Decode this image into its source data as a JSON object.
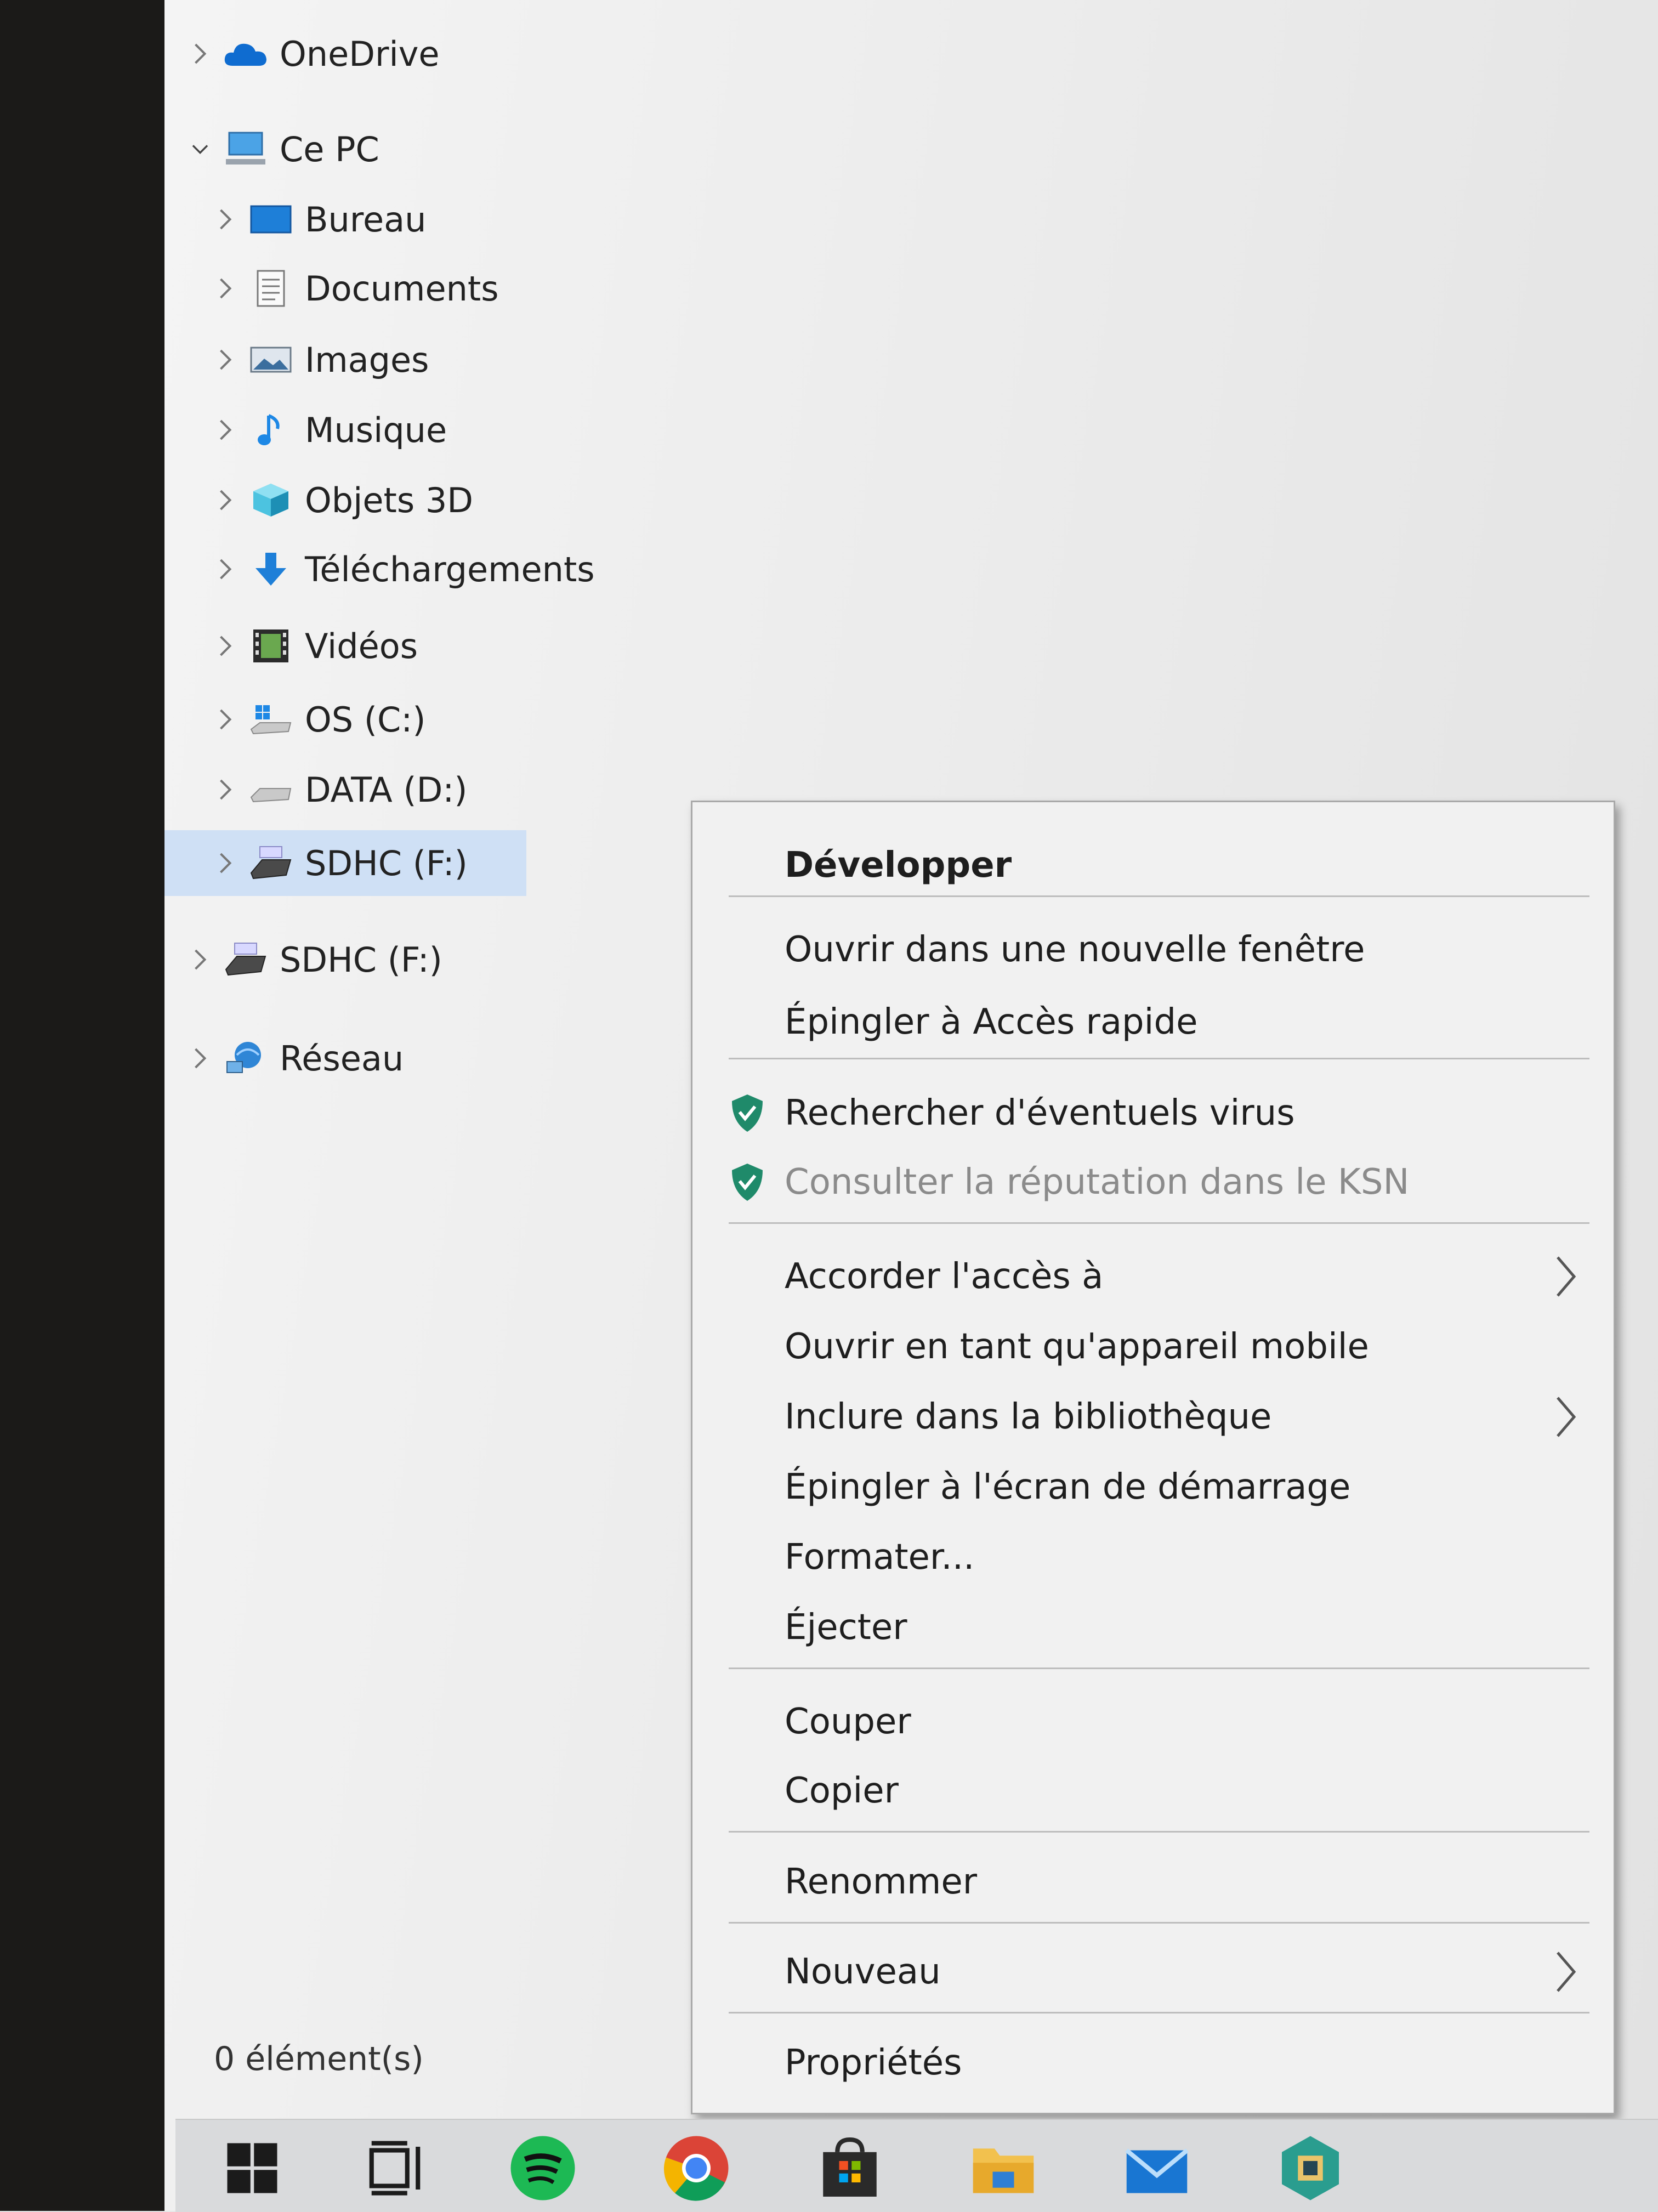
{
  "navigation_pane": {
    "items": [
      {
        "label": "OneDrive",
        "icon": "onedrive-cloud-icon",
        "expanded": false
      },
      {
        "label": "Ce PC",
        "icon": "this-pc-icon",
        "expanded": true
      },
      {
        "label": "Bureau",
        "icon": "desktop-folder-icon"
      },
      {
        "label": "Documents",
        "icon": "documents-folder-icon"
      },
      {
        "label": "Images",
        "icon": "pictures-folder-icon"
      },
      {
        "label": "Musique",
        "icon": "music-folder-icon"
      },
      {
        "label": "Objets 3D",
        "icon": "3d-objects-folder-icon"
      },
      {
        "label": "Téléchargements",
        "icon": "downloads-folder-icon"
      },
      {
        "label": "Vidéos",
        "icon": "videos-folder-icon"
      },
      {
        "label": "OS (C:)",
        "icon": "windows-drive-icon"
      },
      {
        "label": "DATA (D:)",
        "icon": "hard-drive-icon"
      },
      {
        "label": "SDHC (F:)",
        "icon": "sd-card-drive-icon",
        "selected": true
      },
      {
        "label": "SDHC (F:)",
        "icon": "sd-card-drive-icon"
      },
      {
        "label": "Réseau",
        "icon": "network-icon"
      }
    ]
  },
  "status_bar": {
    "item_count": "0 élément(s)"
  },
  "context_menu": {
    "items": [
      {
        "label": "Développer",
        "bold": true
      },
      {
        "label": "Ouvrir dans une nouvelle fenêtre"
      },
      {
        "label": "Épingler à Accès rapide"
      },
      {
        "label": "Rechercher d'éventuels virus",
        "icon": "kaspersky-shield-icon"
      },
      {
        "label": "Consulter la réputation dans le KSN",
        "icon": "kaspersky-shield-icon",
        "disabled": true
      },
      {
        "label": "Accorder l'accès à",
        "submenu": true
      },
      {
        "label": "Ouvrir en tant qu'appareil mobile"
      },
      {
        "label": "Inclure dans la bibliothèque",
        "submenu": true
      },
      {
        "label": "Épingler à l'écran de démarrage"
      },
      {
        "label": "Formater..."
      },
      {
        "label": "Éjecter"
      },
      {
        "label": "Couper"
      },
      {
        "label": "Copier"
      },
      {
        "label": "Renommer"
      },
      {
        "label": "Nouveau",
        "submenu": true
      },
      {
        "label": "Propriétés"
      }
    ]
  },
  "taskbar": {
    "icons": [
      "windows-start-icon",
      "task-view-icon",
      "spotify-icon",
      "chrome-icon",
      "microsoft-store-icon",
      "file-explorer-icon",
      "mail-icon",
      "app-icon"
    ]
  },
  "colors": {
    "selection": "#cfe0f5",
    "kaspersky_green": "#1f8a6a",
    "onedrive_blue": "#0f6cd0",
    "spotify_green": "#1db954"
  }
}
